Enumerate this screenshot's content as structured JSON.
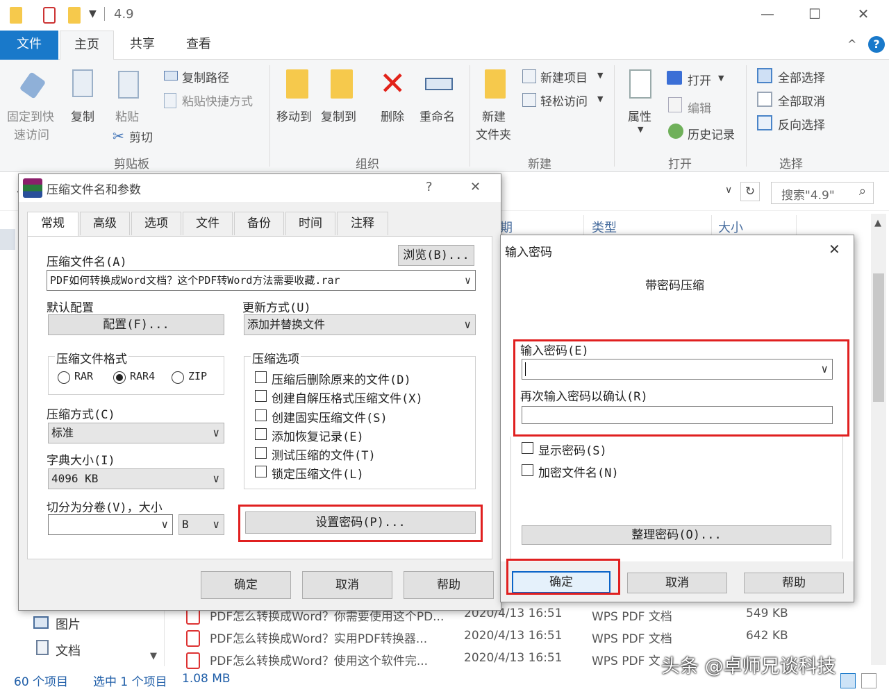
{
  "window": {
    "title": "4.9",
    "minimize": "—",
    "maximize": "☐",
    "close": "✕"
  },
  "ribbon_tabs": [
    {
      "label": "文件"
    },
    {
      "label": "主页"
    },
    {
      "label": "共享"
    },
    {
      "label": "查看"
    }
  ],
  "ribbon": {
    "pin_line1": "固定到快",
    "pin_line2": "速访问",
    "copy": "复制",
    "paste": "粘贴",
    "copy_path": "复制路径",
    "paste_shortcut": "粘贴快捷方式",
    "cut": "剪切",
    "group_clipboard": "剪贴板",
    "move_to": "移动到",
    "copy_to": "复制到",
    "delete": "删除",
    "rename": "重命名",
    "group_organize": "组织",
    "new_folder_line1": "新建",
    "new_folder_line2": "文件夹",
    "new_item": "新建项目",
    "easy_access": "轻松访问",
    "group_new": "新建",
    "properties": "属性",
    "open": "打开",
    "edit": "编辑",
    "history": "历史记录",
    "group_open": "打开",
    "select_all": "全部选择",
    "select_none": "全部取消",
    "invert_select": "反向选择",
    "group_select": "选择",
    "help_icon": "?",
    "collapse_icon": "^"
  },
  "explorer": {
    "search_placeholder": "搜索\"4.9\"",
    "col_date": "期",
    "col_type": "类型",
    "col_size": "大小",
    "nav_pictures": "图片",
    "nav_documents": "文档",
    "files": [
      {
        "name": "PDF怎么转换成Word？你需要使用这个PD...",
        "date": "2020/4/13 16:51",
        "type": "WPS PDF 文档",
        "size": "549 KB"
      },
      {
        "name": "PDF怎么转换成Word？实用PDF转换器...",
        "date": "2020/4/13 16:51",
        "type": "WPS PDF 文档",
        "size": "642 KB"
      },
      {
        "name": "PDF怎么转换成Word？使用这个软件完...",
        "date": "2020/4/13 16:51",
        "type": "WPS PDF 文",
        "size": ""
      }
    ],
    "status_count": "60 个项目",
    "status_selected": "选中 1 个项目",
    "status_size": "1.08 MB"
  },
  "watermark": "头条 @卓师兄谈科技",
  "archive_dialog": {
    "title": "压缩文件名和参数",
    "help": "?",
    "close": "✕",
    "tabs": [
      {
        "label": "常规"
      },
      {
        "label": "高级"
      },
      {
        "label": "选项"
      },
      {
        "label": "文件"
      },
      {
        "label": "备份"
      },
      {
        "label": "时间"
      },
      {
        "label": "注释"
      }
    ],
    "archive_name_label": "压缩文件名(A)",
    "browse": "浏览(B)...",
    "archive_name_value": "PDF如何转换成Word文档？这个PDF转Word方法需要收藏.rar",
    "default_profile_label": "默认配置",
    "profiles_button": "配置(F)...",
    "update_mode_label": "更新方式(U)",
    "update_mode_value": "添加并替换文件",
    "format_label": "压缩文件格式",
    "format_rar": "RAR",
    "format_rar4": "RAR4",
    "format_zip": "ZIP",
    "options_label": "压缩选项",
    "options": [
      {
        "label": "压缩后删除原来的文件(D)",
        "checked": false
      },
      {
        "label": "创建自解压格式压缩文件(X)",
        "checked": false
      },
      {
        "label": "创建固实压缩文件(S)",
        "checked": false
      },
      {
        "label": "添加恢复记录(E)",
        "checked": false
      },
      {
        "label": "测试压缩的文件(T)",
        "checked": false
      },
      {
        "label": "锁定压缩文件(L)",
        "checked": false
      }
    ],
    "method_label": "压缩方式(C)",
    "method_value": "标准",
    "dict_label": "字典大小(I)",
    "dict_value": "4096 KB",
    "split_label": "切分为分卷(V)，大小",
    "split_value": "",
    "split_unit": "B",
    "set_password": "设置密码(P)...",
    "ok": "确定",
    "cancel": "取消",
    "help_button": "帮助"
  },
  "password_dialog": {
    "title": "输入密码",
    "close": "✕",
    "heading": "带密码压缩",
    "enter_label": "输入密码(E)",
    "enter_value": "",
    "reenter_label": "再次输入密码以确认(R)",
    "reenter_value": "",
    "show_password": "显示密码(S)",
    "encrypt_names": "加密文件名(N)",
    "organize": "整理密码(O)...",
    "ok": "确定",
    "cancel": "取消",
    "help_button": "帮助"
  },
  "colors": {
    "accent": "#1979ca",
    "highlight": "#e02020"
  }
}
